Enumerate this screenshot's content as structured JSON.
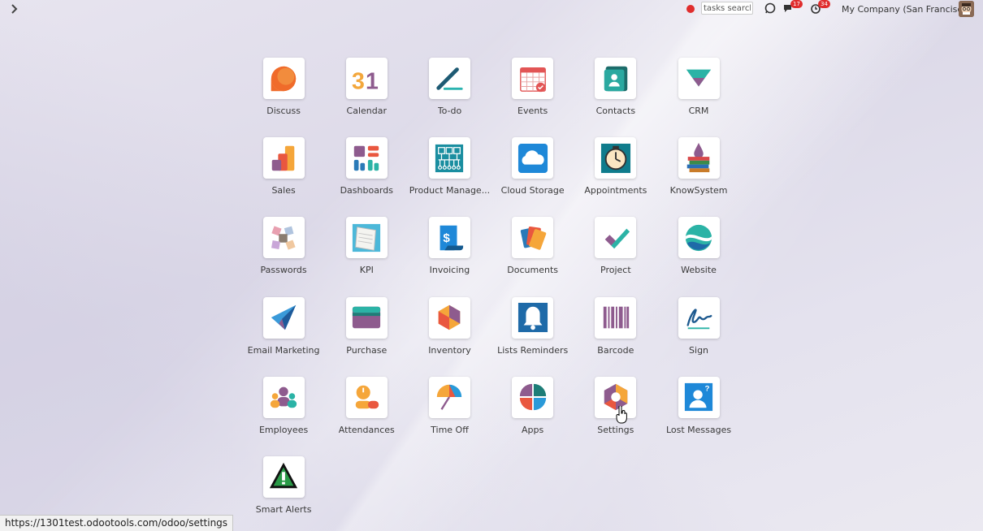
{
  "topbar": {
    "search_placeholder": "tasks search",
    "messages_count": "17",
    "activities_count": "34",
    "company": "My Company (San Francisco)"
  },
  "apps": [
    {
      "label": "Discuss",
      "icon": "discuss-icon"
    },
    {
      "label": "Calendar",
      "icon": "calendar-icon"
    },
    {
      "label": "To-do",
      "icon": "todo-icon"
    },
    {
      "label": "Events",
      "icon": "events-icon"
    },
    {
      "label": "Contacts",
      "icon": "contacts-icon"
    },
    {
      "label": "CRM",
      "icon": "crm-icon"
    },
    {
      "label": "Sales",
      "icon": "sales-icon"
    },
    {
      "label": "Dashboards",
      "icon": "dashboards-icon"
    },
    {
      "label": "Product Manage...",
      "icon": "product-management-icon"
    },
    {
      "label": "Cloud Storage",
      "icon": "cloud-storage-icon"
    },
    {
      "label": "Appointments",
      "icon": "appointments-icon"
    },
    {
      "label": "KnowSystem",
      "icon": "knowsystem-icon"
    },
    {
      "label": "Passwords",
      "icon": "passwords-icon"
    },
    {
      "label": "KPI",
      "icon": "kpi-icon"
    },
    {
      "label": "Invoicing",
      "icon": "invoicing-icon"
    },
    {
      "label": "Documents",
      "icon": "documents-icon"
    },
    {
      "label": "Project",
      "icon": "project-icon"
    },
    {
      "label": "Website",
      "icon": "website-icon"
    },
    {
      "label": "Email Marketing",
      "icon": "email-marketing-icon"
    },
    {
      "label": "Purchase",
      "icon": "purchase-icon"
    },
    {
      "label": "Inventory",
      "icon": "inventory-icon"
    },
    {
      "label": "Lists Reminders",
      "icon": "lists-reminders-icon"
    },
    {
      "label": "Barcode",
      "icon": "barcode-icon"
    },
    {
      "label": "Sign",
      "icon": "sign-icon"
    },
    {
      "label": "Employees",
      "icon": "employees-icon"
    },
    {
      "label": "Attendances",
      "icon": "attendances-icon"
    },
    {
      "label": "Time Off",
      "icon": "time-off-icon"
    },
    {
      "label": "Apps",
      "icon": "apps-icon"
    },
    {
      "label": "Settings",
      "icon": "settings-icon"
    },
    {
      "label": "Lost Messages",
      "icon": "lost-messages-icon"
    },
    {
      "label": "Smart Alerts",
      "icon": "smart-alerts-icon"
    }
  ],
  "statusbar": {
    "url": "https://1301test.odootools.com/odoo/settings"
  }
}
